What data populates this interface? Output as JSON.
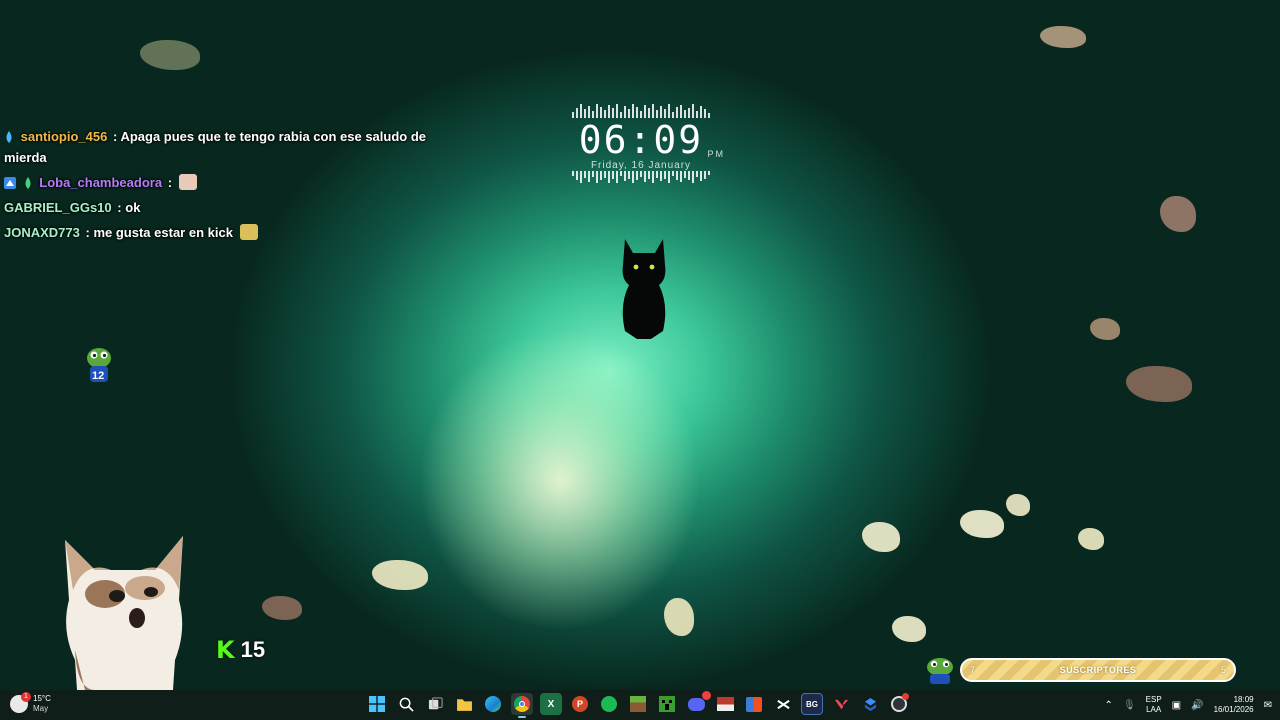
{
  "clock": {
    "time": "06:09",
    "ampm": "PM",
    "date": "Friday, 16 January"
  },
  "chat": [
    {
      "user": "santiopio_456",
      "user_color": "#f0b84a",
      "text": "Apaga pues que te tengo rabia con ese saludo de mierda",
      "badges": [
        "drop"
      ]
    },
    {
      "user": "Loba_chambeadora",
      "user_color": "#b57bf5",
      "text": "",
      "badges": [
        "vip",
        "drop"
      ],
      "emote": "cat-emote"
    },
    {
      "user": "GABRIEL_GGs10",
      "user_color": "#a8f0c8",
      "text": "ok",
      "badges": []
    },
    {
      "user": "JONAXD773",
      "user_color": "#a8f0c8",
      "text": "me gusta estar en kick",
      "badges": [],
      "emote": "sunglasses-emote"
    }
  ],
  "overlay": {
    "frog_badge_icon": "pepe-frog-icon",
    "frog_badge_number": "12",
    "popcat_icon": "pop-cat-icon",
    "kick_letter": "K",
    "kick_count": "15",
    "sub_goal": {
      "current": "7",
      "label": "SUSCRIPTORES",
      "goal": "5"
    }
  },
  "taskbar": {
    "weather": {
      "temp": "15°C",
      "text": "May",
      "icon": "weather-icon"
    },
    "apps": [
      {
        "name": "start",
        "icon": "windows-icon",
        "color": "#4cc2ff",
        "label": ""
      },
      {
        "name": "search",
        "icon": "search-icon",
        "color": "transparent",
        "label": ""
      },
      {
        "name": "task-view",
        "icon": "task-view-icon",
        "color": "transparent",
        "label": ""
      },
      {
        "name": "file-explorer",
        "icon": "folder-icon",
        "color": "#f4c542",
        "label": ""
      },
      {
        "name": "edge",
        "icon": "edge-icon",
        "color": "#2aa3d9",
        "label": ""
      },
      {
        "name": "chrome",
        "icon": "chrome-icon",
        "color": "#e8453c",
        "label": ""
      },
      {
        "name": "excel",
        "icon": "excel-icon",
        "color": "#1d7044",
        "label": ""
      },
      {
        "name": "powerpoint",
        "icon": "powerpoint-icon",
        "color": "#d24625",
        "label": ""
      },
      {
        "name": "spotify",
        "icon": "spotify-icon",
        "color": "#1db954",
        "label": ""
      },
      {
        "name": "minecraft",
        "icon": "minecraft-icon",
        "color": "#6b8e3a",
        "label": ""
      },
      {
        "name": "minecraft-launcher",
        "icon": "creeper-icon",
        "color": "#3a9d2f",
        "label": ""
      },
      {
        "name": "discord",
        "icon": "discord-icon",
        "color": "#5865f2",
        "label": ""
      },
      {
        "name": "app-red",
        "icon": "capture-icon",
        "color": "#c0392b",
        "label": ""
      },
      {
        "name": "store",
        "icon": "store-icon",
        "color": "#3b7dd8",
        "label": ""
      },
      {
        "name": "capcut",
        "icon": "capcut-icon",
        "color": "#111111",
        "label": ""
      },
      {
        "name": "bg-app",
        "icon": "bg-icon",
        "color": "#1d2a4a",
        "label": "BG"
      },
      {
        "name": "valorant",
        "icon": "valorant-icon",
        "color": "#2b2b2b",
        "label": ""
      },
      {
        "name": "app-blue",
        "icon": "blue-app-icon",
        "color": "#2a5fc9",
        "label": ""
      },
      {
        "name": "obs",
        "icon": "obs-icon",
        "color": "#30333a",
        "label": ""
      }
    ],
    "tray": {
      "lang_top": "ESP",
      "lang_bottom": "LAA",
      "time": "18:09",
      "date": "16/01/2026"
    }
  }
}
